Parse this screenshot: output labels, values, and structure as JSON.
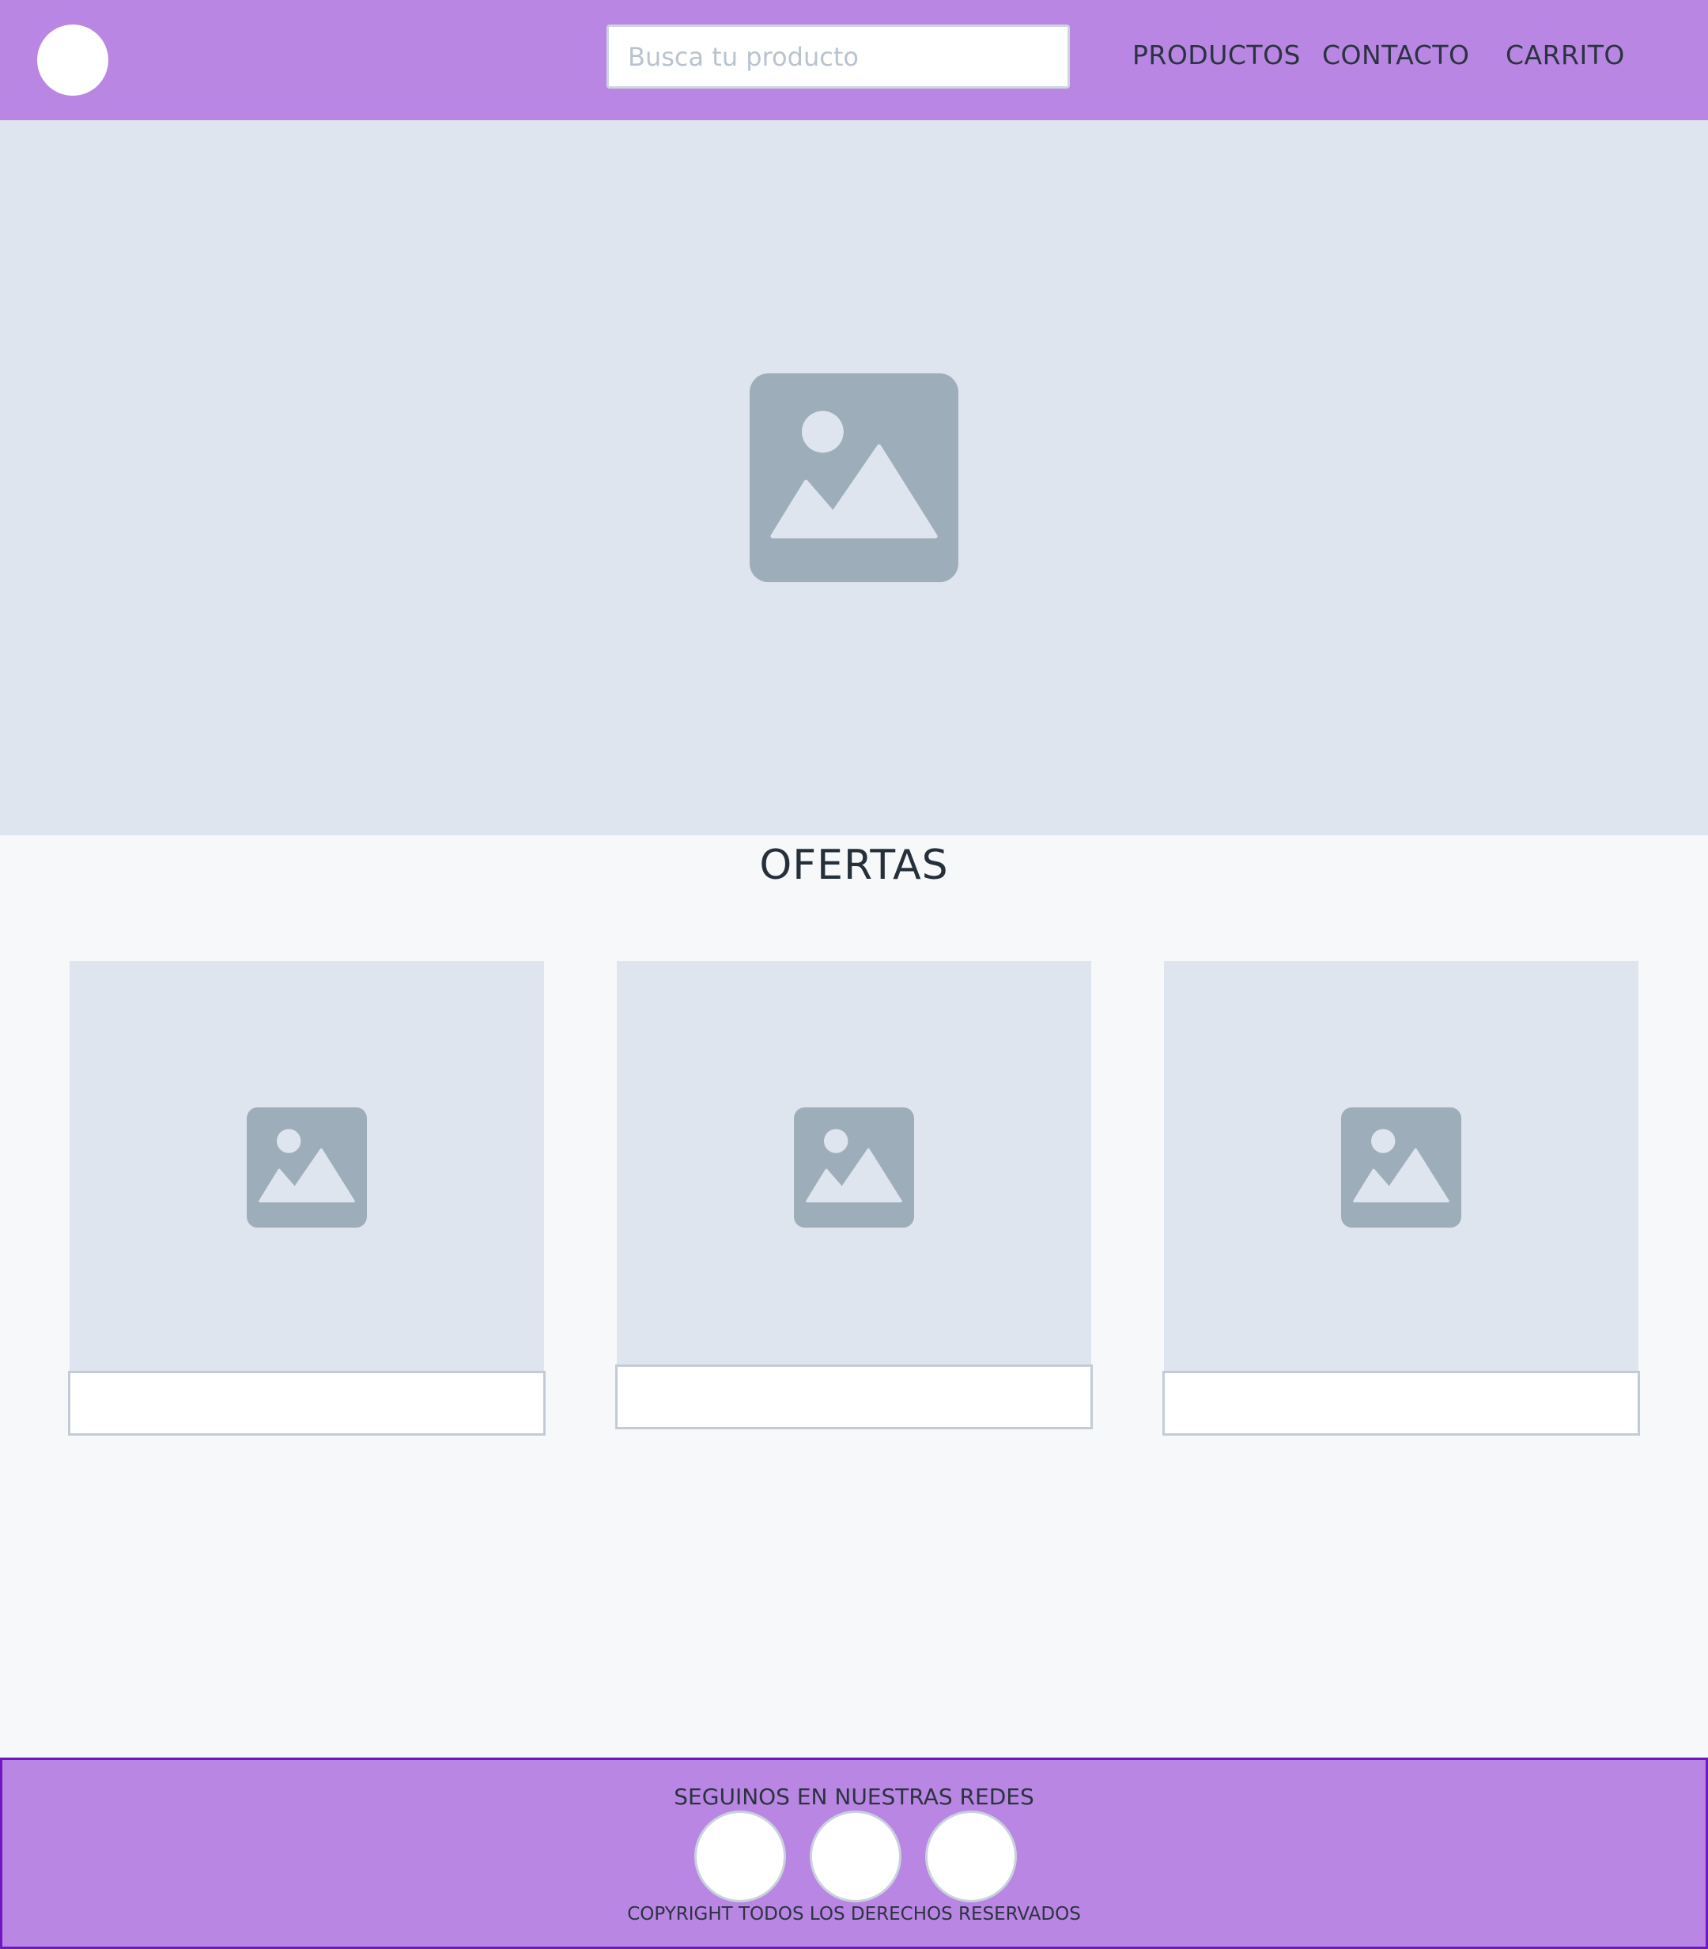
{
  "header": {
    "search_placeholder": "Busca tu producto",
    "nav": [
      {
        "label": "PRODUCTOS"
      },
      {
        "label": "CONTACTO"
      },
      {
        "label": "CARRITO"
      }
    ]
  },
  "hero": {
    "icon": "image-placeholder-icon"
  },
  "offers": {
    "title": "OFERTAS",
    "cards": [
      {
        "icon": "image-placeholder-icon"
      },
      {
        "icon": "image-placeholder-icon"
      },
      {
        "icon": "image-placeholder-icon"
      }
    ]
  },
  "footer": {
    "title": "SEGUINOS EN NUESTRAS REDES",
    "copyright": "COPYRIGHT TODOS LOS DERECHOS RESERVADOS"
  },
  "colors": {
    "brand": "#b987e3",
    "placeholder_bg": "#dfe5ee",
    "placeholder_icon": "#9eadba",
    "footer_border": "#6e18c4"
  }
}
